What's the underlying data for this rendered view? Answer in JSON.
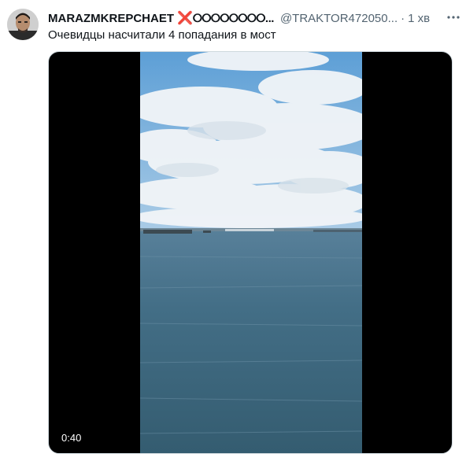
{
  "tweet": {
    "author_name": "MARAZMKREPCHAET",
    "emoji_cross": "❌",
    "emoji_circles": "⭘⭘⭘⭘⭘⭘⭘⭘...",
    "handle": "@TRAKTOR472050...",
    "separator": "·",
    "time": "1 хв",
    "text": "Очевидцы насчитали 4 попадания в мост",
    "more_icon": "ellipsis-icon"
  },
  "media": {
    "duration": "0:40"
  },
  "colors": {
    "sky": "#6aa9d9",
    "sea": "#3f6a80",
    "accent_red": "#e0245e",
    "muted": "#536471"
  }
}
